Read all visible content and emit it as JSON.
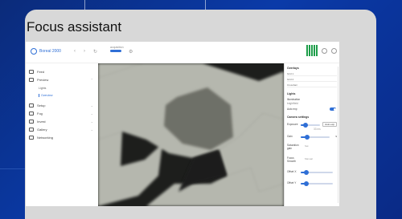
{
  "card": {
    "title": "Focus assistant"
  },
  "app": {
    "name": "Boreal 2000",
    "status_text": "acquisition",
    "sidebar": [
      {
        "label": "Feed",
        "icon": "square-icon"
      },
      {
        "label": "Preview",
        "icon": "monitor-icon",
        "children": [
          "Lights",
          "Overview"
        ]
      },
      {
        "label": "Setup",
        "icon": "tool-icon"
      },
      {
        "label": "Fog",
        "icon": "cloud-icon"
      },
      {
        "label": "Invest",
        "icon": "chart-icon"
      },
      {
        "label": "Gallery",
        "icon": "image-icon"
      },
      {
        "label": "Networking",
        "icon": "network-icon"
      }
    ],
    "panel": {
      "section1_title": "Overlays",
      "section1_rows": [
        "Grid 1",
        "Grid 2",
        "Crosshair"
      ],
      "section2_title": "Lights",
      "lights_label": "Illumination",
      "lights_value": "brightfield",
      "lights_toggle": "Auto exp",
      "section3_title": "Camera settings",
      "exposure_label": "Exposure",
      "exposure_value": "3",
      "exposure_button": "Auto exp",
      "exposure_units": "33 ms",
      "gain_label": "Gain",
      "gain_value": "9",
      "saturation_label": "Saturation gain",
      "saturation_value": "Sat",
      "focus_label": "Focus Smooth",
      "focus_value": "Manual",
      "offset1_label": "Offset X",
      "offset2_label": "Offset Y"
    }
  },
  "colors": {
    "accent": "#2f6fd6",
    "background": "#0a3aa8",
    "card": "#d8d8d8"
  }
}
